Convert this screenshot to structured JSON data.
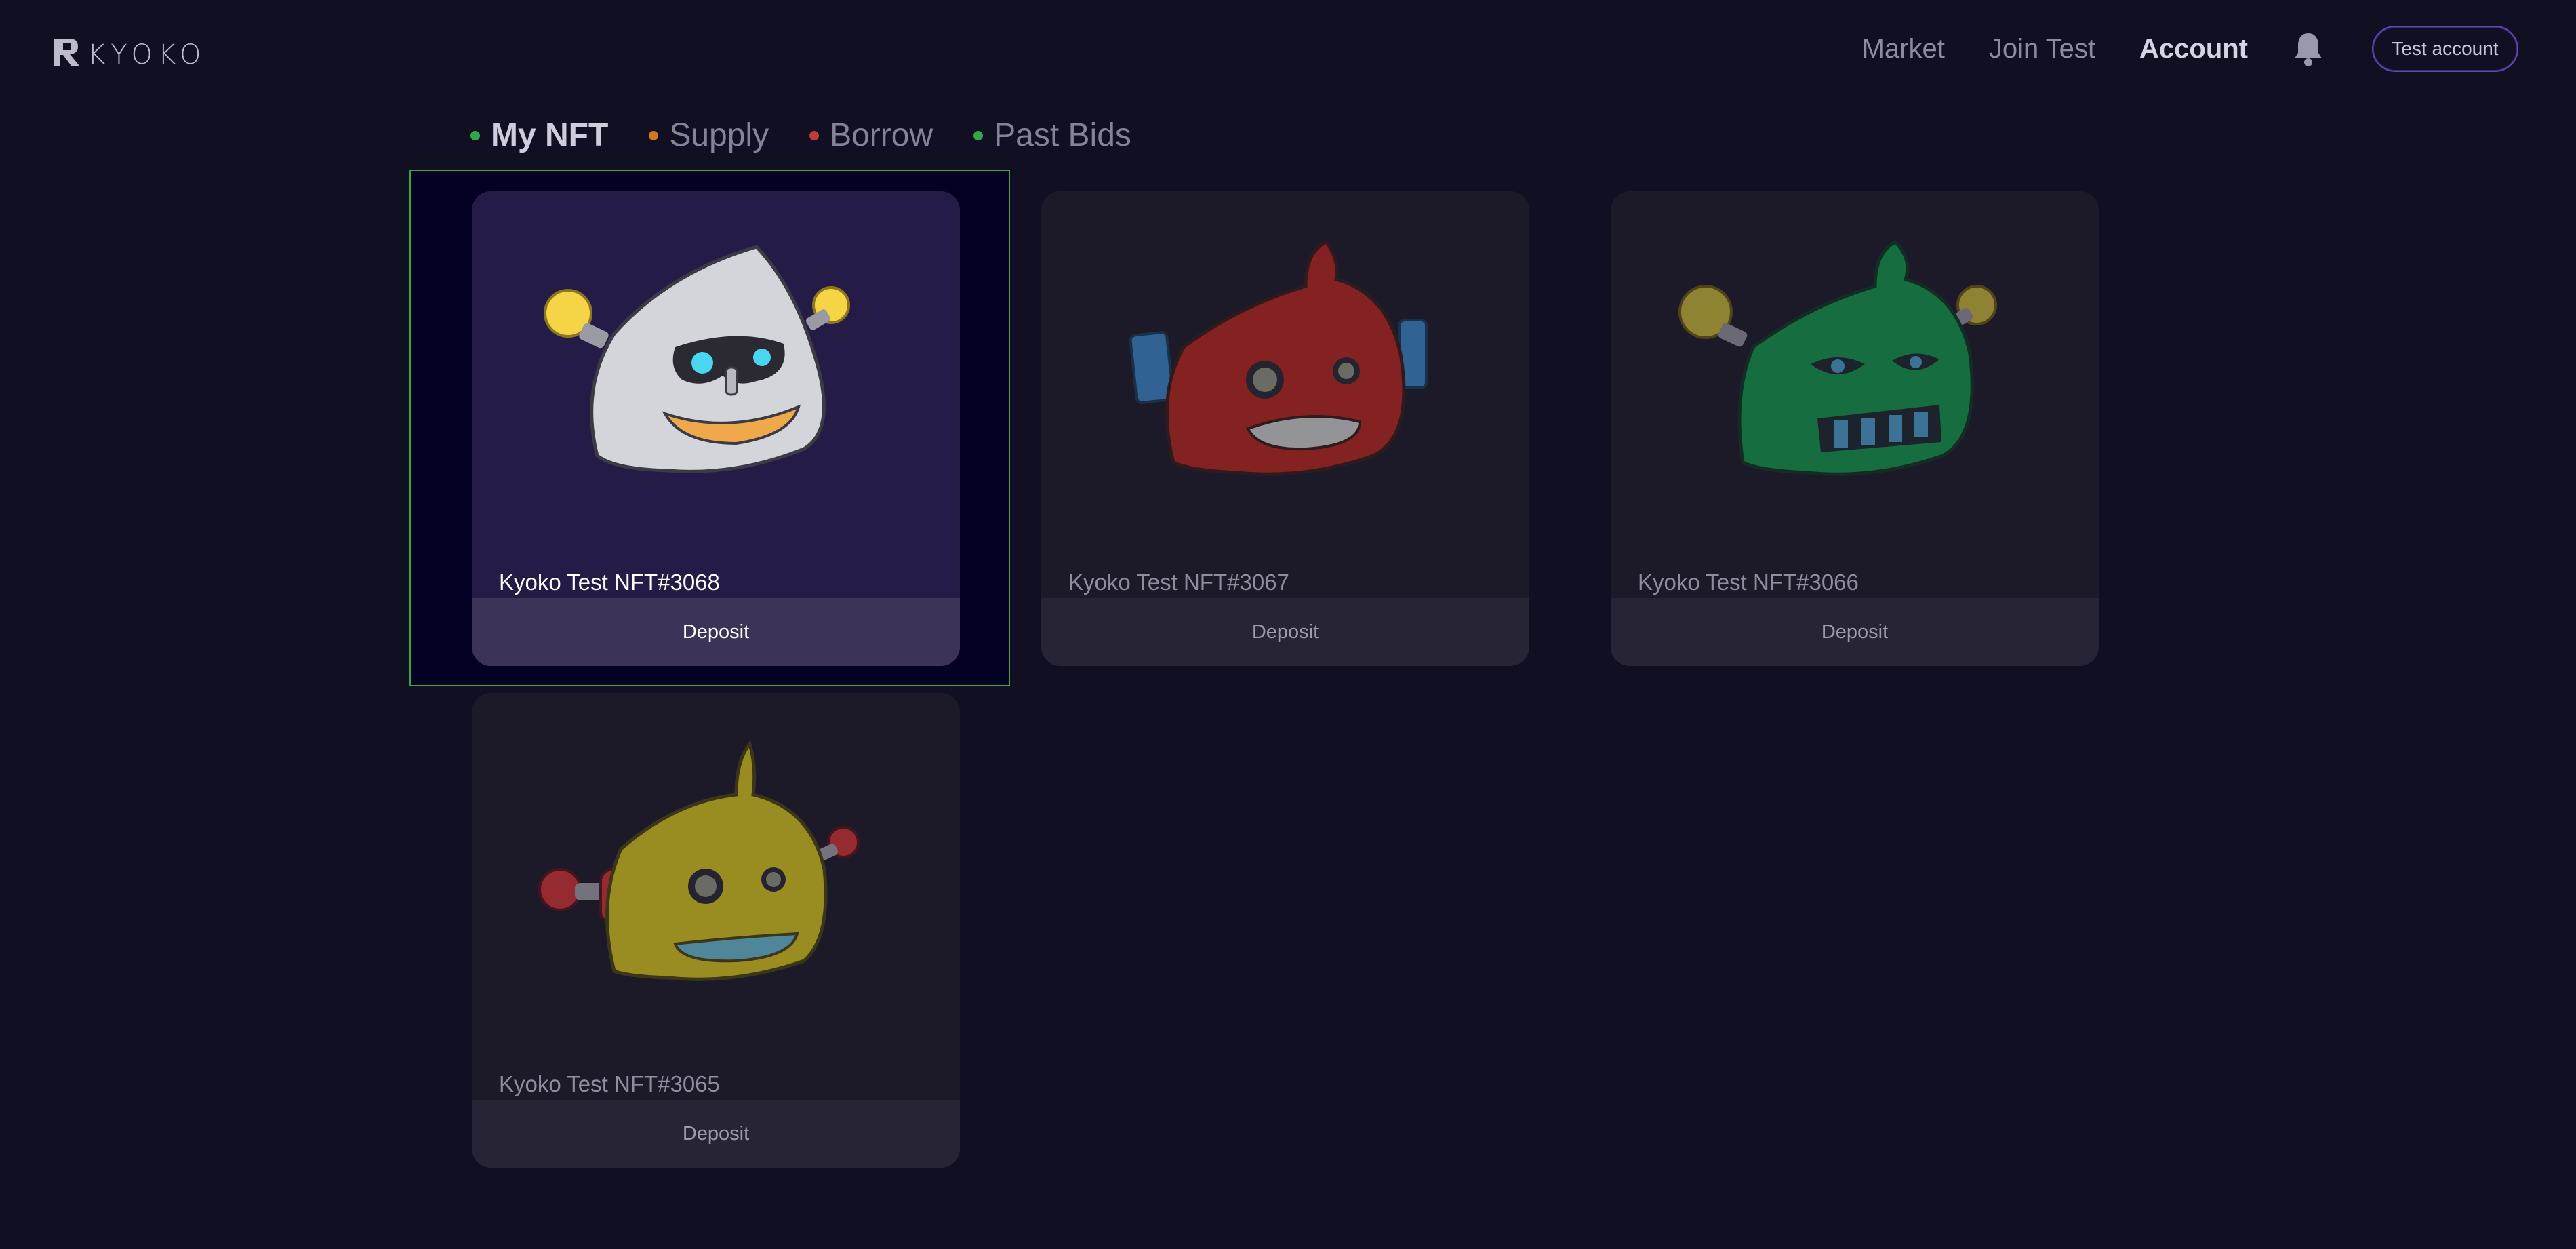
{
  "brand": {
    "name": "KYOKO",
    "accent": "#6a3fc2"
  },
  "nav": {
    "links": [
      "Market",
      "Join Test",
      "Account"
    ],
    "active": "Account",
    "notification_icon": "bell-icon",
    "account_button": "Test account"
  },
  "tabs": [
    {
      "label": "My NFT",
      "dot_color": "#2fa84a",
      "active": true
    },
    {
      "label": "Supply",
      "dot_color": "#d07a1c",
      "active": false
    },
    {
      "label": "Borrow",
      "dot_color": "#c23b3b",
      "active": false
    },
    {
      "label": "Past Bids",
      "dot_color": "#2fa84a",
      "active": false
    }
  ],
  "nfts": [
    {
      "name": "Kyoko Test NFT#3068",
      "action": "Deposit",
      "color": "#c9c9cf",
      "selected": true
    },
    {
      "name": "Kyoko Test NFT#3067",
      "action": "Deposit",
      "color": "#c0281f",
      "selected": false
    },
    {
      "name": "Kyoko Test NFT#3066",
      "action": "Deposit",
      "color": "#12a04e",
      "selected": false
    },
    {
      "name": "Kyoko Test NFT#3065",
      "action": "Deposit",
      "color": "#d8c51a",
      "selected": false
    }
  ]
}
